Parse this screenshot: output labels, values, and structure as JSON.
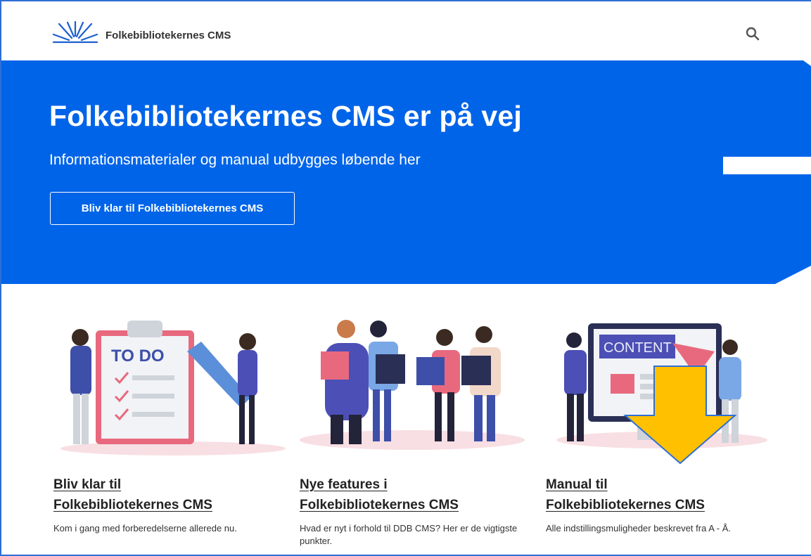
{
  "header": {
    "brand": "Folkebibliotekernes CMS",
    "logo_icon": "sunburst-logo-icon",
    "search_icon": "search-icon"
  },
  "hero": {
    "title": "Folkebibliotekernes CMS er på vej",
    "subtitle": "Informationsmaterialer og manual udbygges løbende her",
    "button_label": "Bliv klar til Folkebibliotekernes CMS",
    "background_color": "#0064e8"
  },
  "cards": [
    {
      "title_line1": "Bliv klar til",
      "title_line2": "Folkebibliotekernes CMS",
      "text": "Kom i gang med forberedelserne allerede nu.",
      "illustration_text": "TO DO"
    },
    {
      "title_line1": "Nye features i",
      "title_line2": "Folkebibliotekernes CMS",
      "text": "Hvad er nyt i forhold til DDB CMS? Her er de vigtigste punkter."
    },
    {
      "title_line1": "Manual til",
      "title_line2": "Folkebibliotekernes CMS",
      "text": "Alle indstillingsmuligheder beskrevet fra A - Å.",
      "illustration_text": "CONTENT"
    }
  ],
  "annotation": {
    "arrow_color": "#ffc000",
    "arrow_icon": "down-arrow-icon"
  }
}
